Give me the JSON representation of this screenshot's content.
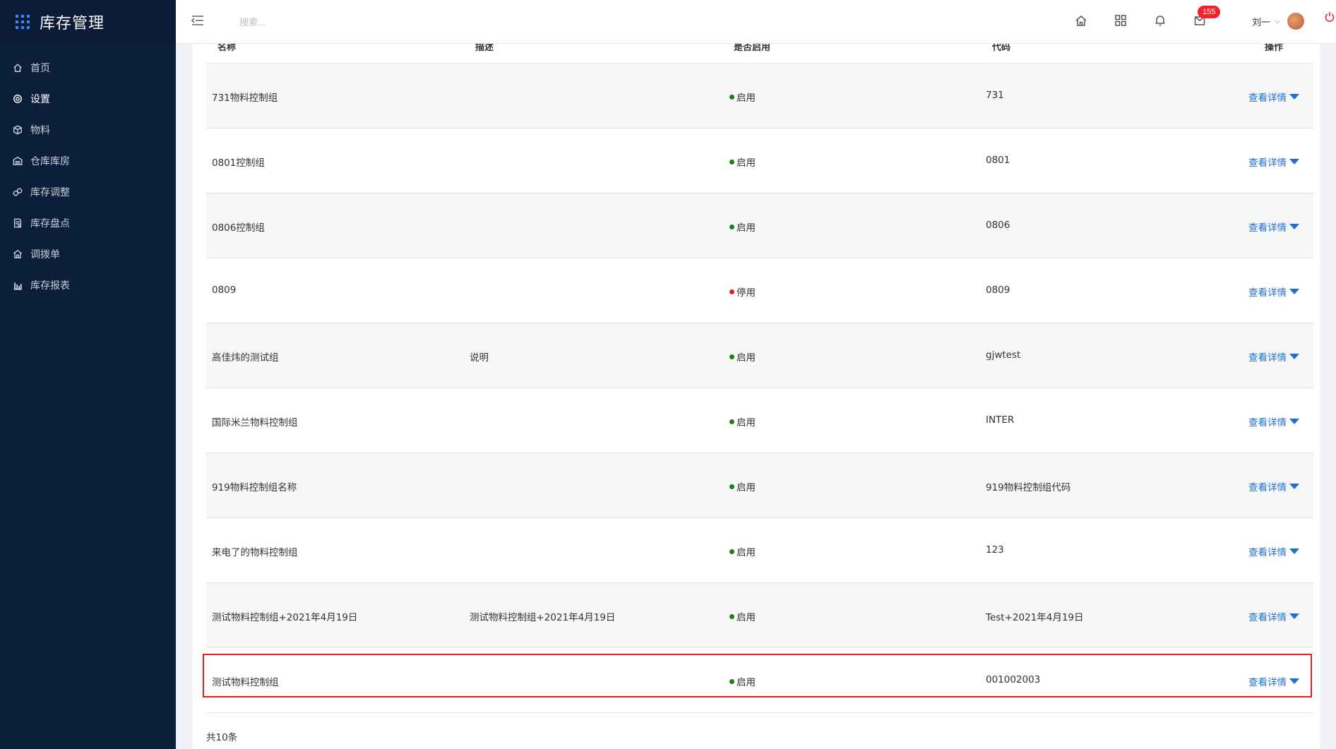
{
  "app": {
    "title": "库存管理"
  },
  "sidebar": {
    "items": [
      {
        "label": "首页",
        "icon": "home-icon"
      },
      {
        "label": "设置",
        "icon": "gear-icon",
        "active": true
      },
      {
        "label": "物料",
        "icon": "cube-icon"
      },
      {
        "label": "仓库库房",
        "icon": "warehouse-icon"
      },
      {
        "label": "库存调整",
        "icon": "adjust-icon"
      },
      {
        "label": "库存盘点",
        "icon": "inventory-check-icon"
      },
      {
        "label": "调拨单",
        "icon": "transfer-icon"
      },
      {
        "label": "库存报表",
        "icon": "bar-chart-icon"
      }
    ]
  },
  "topbar": {
    "search_placeholder": "搜索...",
    "badge_count": "155",
    "user_name": "刘一"
  },
  "table": {
    "headers": {
      "name": "名称",
      "desc": "描述",
      "status": "是否启用",
      "code": "代码",
      "op": "操作"
    },
    "rows": [
      {
        "name": "731物料控制组",
        "desc": "",
        "status": "启用",
        "code": "731",
        "op": "查看详情"
      },
      {
        "name": "0801控制组",
        "desc": "",
        "status": "启用",
        "code": "0801",
        "op": "查看详情"
      },
      {
        "name": "0806控制组",
        "desc": "",
        "status": "启用",
        "code": "0806",
        "op": "查看详情"
      },
      {
        "name": "0809",
        "desc": "",
        "status": "停用",
        "code": "0809",
        "op": "查看详情"
      },
      {
        "name": "高佳炜的测试组",
        "desc": "说明",
        "status": "启用",
        "code": "gjwtest",
        "op": "查看详情"
      },
      {
        "name": "国际米兰物料控制组",
        "desc": "",
        "status": "启用",
        "code": "INTER",
        "op": "查看详情"
      },
      {
        "name": "919物料控制组名称",
        "desc": "",
        "status": "启用",
        "code": "919物料控制组代码",
        "op": "查看详情"
      },
      {
        "name": "来电了的物料控制组",
        "desc": "",
        "status": "启用",
        "code": "123",
        "op": "查看详情"
      },
      {
        "name": "测试物料控制组+2021年4月19日",
        "desc": "测试物料控制组+2021年4月19日",
        "status": "启用",
        "code": "Test+2021年4月19日",
        "op": "查看详情"
      },
      {
        "name": "测试物料控制组",
        "desc": "",
        "status": "启用",
        "code": "001002003",
        "op": "查看详情"
      }
    ],
    "total": "共10条"
  },
  "colors": {
    "enabled": "#1a7f1a",
    "disabled": "#e02020",
    "link": "#1f6fd6",
    "sidebar": "#0b1f3a"
  }
}
